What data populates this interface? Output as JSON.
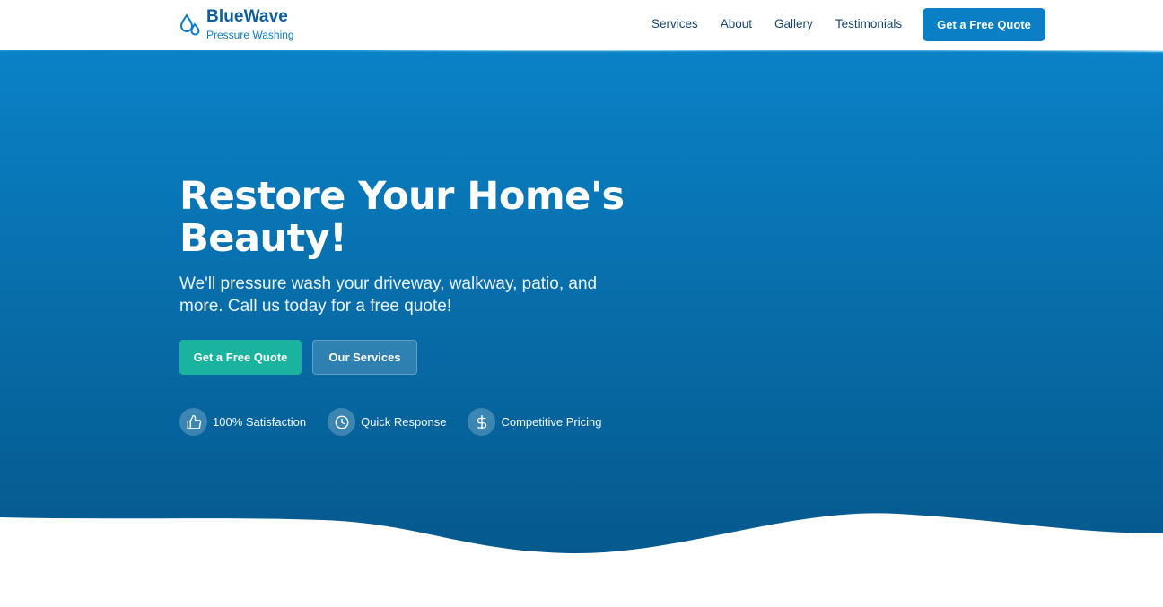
{
  "header": {
    "brand": "BlueWave",
    "tagline": "Pressure Washing",
    "nav": [
      "Services",
      "About",
      "Gallery",
      "Testimonials"
    ],
    "cta_label": "Get a Free Quote"
  },
  "hero": {
    "title_line1": "Restore Your Home's",
    "title_line2": "Beauty!",
    "subtitle": "We'll pressure wash your driveway, walkway, patio, and more. Call us today for a free quote!",
    "primary_button": "Get a Free Quote",
    "secondary_button": "Our Services",
    "features": [
      {
        "icon": "thumbs-up-icon",
        "label": "100% Satisfaction"
      },
      {
        "icon": "clock-icon",
        "label": "Quick Response"
      },
      {
        "icon": "dollar-icon",
        "label": "Competitive Pricing"
      }
    ]
  },
  "colors": {
    "hero_top": "#0a82c7",
    "hero_bottom": "#055c91",
    "brand": "#0b5e9a",
    "accent_teal": "#1ab39f",
    "cta_blue": "#0a7fc6"
  }
}
